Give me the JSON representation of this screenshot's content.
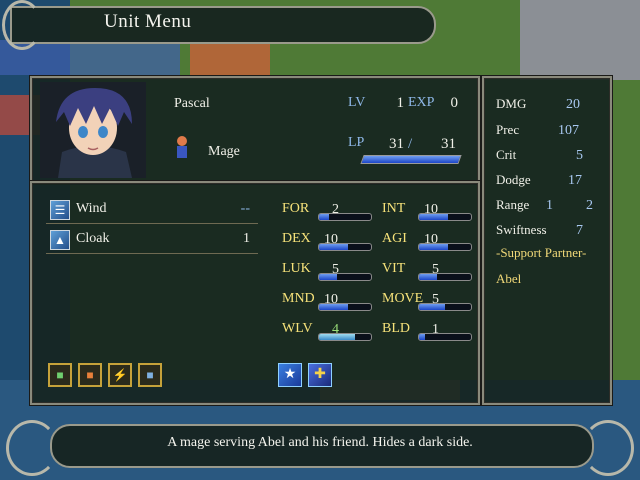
{
  "title": "Unit Menu",
  "unit": {
    "name": "Pascal",
    "class": "Mage",
    "lv_label": "LV",
    "lv": "1",
    "exp_label": "EXP",
    "exp": "0",
    "lp_label": "LP",
    "lp_current": "31",
    "lp_sep": "/",
    "lp_max": "31",
    "lp_fraction": 1.0
  },
  "items": [
    {
      "name": "Wind",
      "uses": "--",
      "icon": "tome-icon"
    },
    {
      "name": "Cloak",
      "uses": "1",
      "icon": "cloak-icon"
    }
  ],
  "stats": {
    "for": {
      "label": "FOR",
      "value": "2",
      "fraction": 0.2
    },
    "int": {
      "label": "INT",
      "value": "10",
      "fraction": 0.55
    },
    "dex": {
      "label": "DEX",
      "value": "10",
      "fraction": 0.55
    },
    "agi": {
      "label": "AGI",
      "value": "10",
      "fraction": 0.55
    },
    "luk": {
      "label": "LUK",
      "value": "5",
      "fraction": 0.35
    },
    "vit": {
      "label": "VIT",
      "value": "5",
      "fraction": 0.35
    },
    "mnd": {
      "label": "MND",
      "value": "10",
      "fraction": 0.55
    },
    "move": {
      "label": "MOVE",
      "value": "5",
      "fraction": 0.5
    },
    "wlv": {
      "label": "WLV",
      "value": "4",
      "fraction": 0.7
    },
    "bld": {
      "label": "BLD",
      "value": "1",
      "fraction": 0.12
    }
  },
  "side": {
    "dmg_label": "DMG",
    "dmg": "20",
    "prec_label": "Prec",
    "prec": "107",
    "crit_label": "Crit",
    "crit": "5",
    "dodge_label": "Dodge",
    "dodge": "17",
    "range_label": "Range",
    "range_min": "1",
    "range_max": "2",
    "swift_label": "Swiftness",
    "swift": "7",
    "support_label": "-Support Partner-",
    "support_partner": "Abel"
  },
  "description": "A mage serving Abel and his friend. Hides a dark side."
}
